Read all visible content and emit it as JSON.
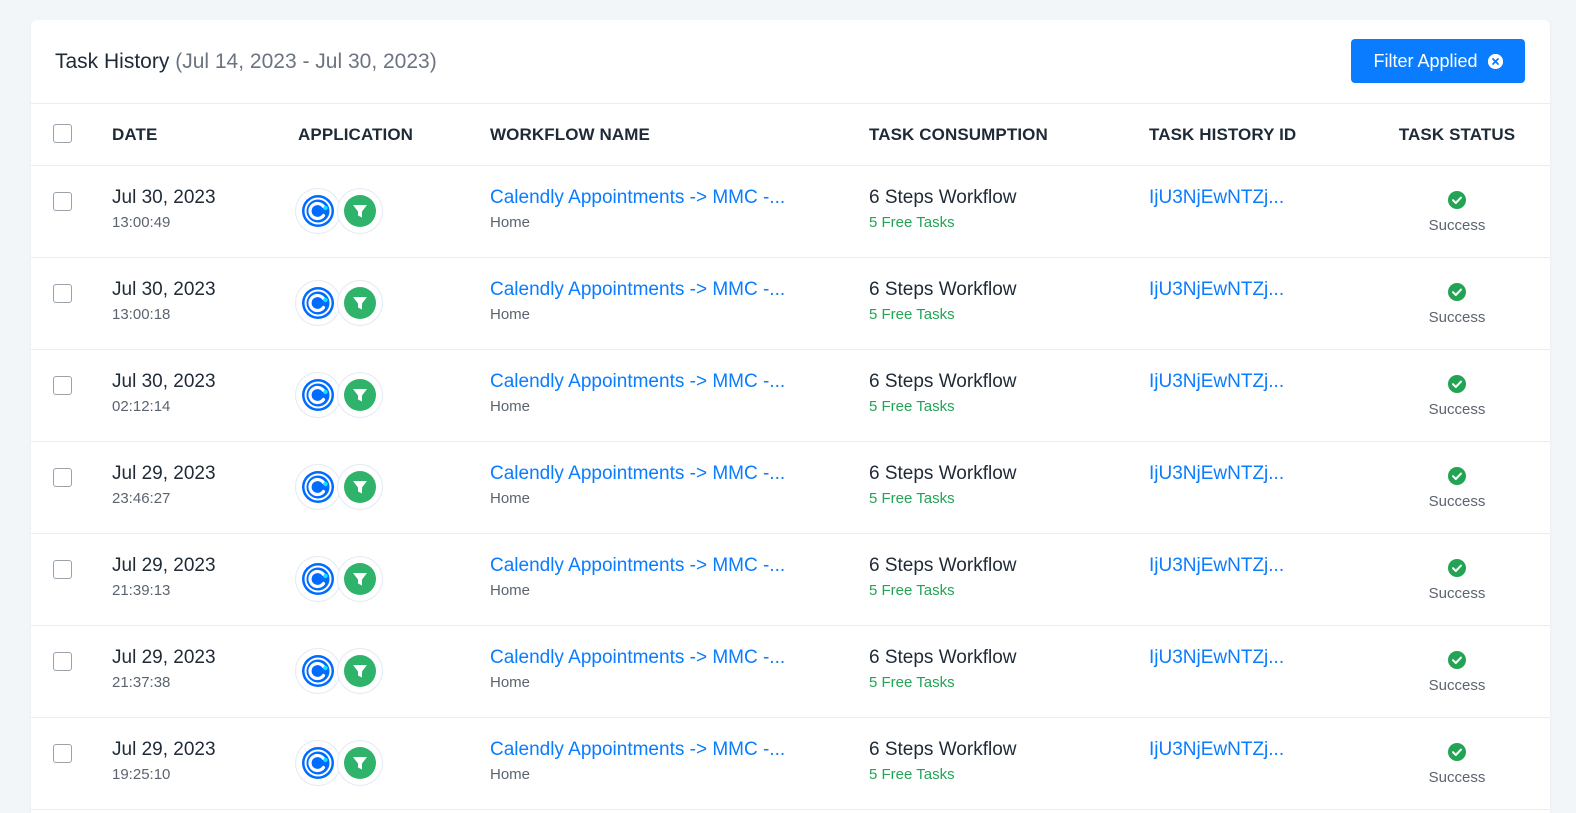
{
  "header": {
    "title": "Task History",
    "date_range": "(Jul 14, 2023 - Jul 30, 2023)",
    "filter_button_label": "Filter Applied"
  },
  "table": {
    "columns": {
      "date": "DATE",
      "application": "APPLICATION",
      "workflow_name": "WORKFLOW NAME",
      "task_consumption": "TASK CONSUMPTION",
      "task_history_id": "TASK HISTORY ID",
      "task_status": "TASK STATUS"
    },
    "rows": [
      {
        "date": "Jul 30, 2023",
        "time": "13:00:49",
        "workflow": "Calendly Appointments -> MMC -...",
        "folder": "Home",
        "steps": "6 Steps Workflow",
        "free_tasks": "5 Free Tasks",
        "history_id": "IjU3NjEwNTZj...",
        "status": "Success"
      },
      {
        "date": "Jul 30, 2023",
        "time": "13:00:18",
        "workflow": "Calendly Appointments -> MMC -...",
        "folder": "Home",
        "steps": "6 Steps Workflow",
        "free_tasks": "5 Free Tasks",
        "history_id": "IjU3NjEwNTZj...",
        "status": "Success"
      },
      {
        "date": "Jul 30, 2023",
        "time": "02:12:14",
        "workflow": "Calendly Appointments -> MMC -...",
        "folder": "Home",
        "steps": "6 Steps Workflow",
        "free_tasks": "5 Free Tasks",
        "history_id": "IjU3NjEwNTZj...",
        "status": "Success"
      },
      {
        "date": "Jul 29, 2023",
        "time": "23:46:27",
        "workflow": "Calendly Appointments -> MMC -...",
        "folder": "Home",
        "steps": "6 Steps Workflow",
        "free_tasks": "5 Free Tasks",
        "history_id": "IjU3NjEwNTZj...",
        "status": "Success"
      },
      {
        "date": "Jul 29, 2023",
        "time": "21:39:13",
        "workflow": "Calendly Appointments -> MMC -...",
        "folder": "Home",
        "steps": "6 Steps Workflow",
        "free_tasks": "5 Free Tasks",
        "history_id": "IjU3NjEwNTZj...",
        "status": "Success"
      },
      {
        "date": "Jul 29, 2023",
        "time": "21:37:38",
        "workflow": "Calendly Appointments -> MMC -...",
        "folder": "Home",
        "steps": "6 Steps Workflow",
        "free_tasks": "5 Free Tasks",
        "history_id": "IjU3NjEwNTZj...",
        "status": "Success"
      },
      {
        "date": "Jul 29, 2023",
        "time": "19:25:10",
        "workflow": "Calendly Appointments -> MMC -...",
        "folder": "Home",
        "steps": "6 Steps Workflow",
        "free_tasks": "5 Free Tasks",
        "history_id": "IjU3NjEwNTZj...",
        "status": "Success"
      }
    ]
  },
  "icons": {
    "first_app": "calendly-icon",
    "second_app": "filter-icon",
    "status": "check-circle-icon",
    "filter_clear": "close-circle-icon"
  },
  "colors": {
    "accent": "#0a7cff",
    "success": "#23a455",
    "calendly": "#006bff",
    "filter_app": "#2fb36b"
  }
}
